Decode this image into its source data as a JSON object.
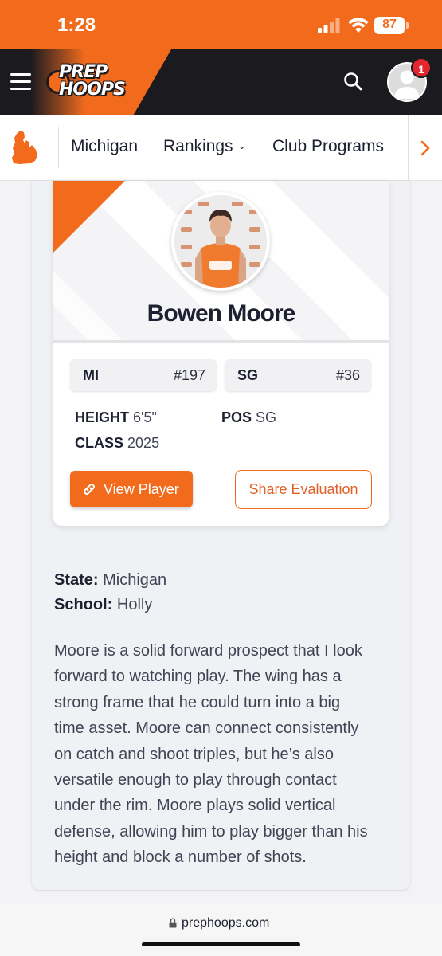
{
  "status_bar": {
    "time": "1:28",
    "battery": "87"
  },
  "header": {
    "logo_line1": "PREP",
    "logo_line2": "HOOPS",
    "notification_count": "1"
  },
  "subnav": {
    "items": [
      {
        "label": "Michigan"
      },
      {
        "label": "Rankings"
      },
      {
        "label": "Club Programs"
      }
    ]
  },
  "player": {
    "name": "Bowen Moore",
    "rankings": [
      {
        "label": "MI",
        "value": "#197"
      },
      {
        "label": "SG",
        "value": "#36"
      }
    ],
    "stats": {
      "height_label": "HEIGHT",
      "height_value": "6'5\"",
      "pos_label": "POS",
      "pos_value": "SG",
      "class_label": "CLASS",
      "class_value": "2025"
    },
    "view_button": "View Player",
    "share_button": "Share Evaluation"
  },
  "info": {
    "state_label": "State:",
    "state_value": "Michigan",
    "school_label": "School:",
    "school_value": "Holly"
  },
  "bio_lines": [
    "Moore is a solid forward prospect that I look",
    "forward to watching play. The wing has a",
    "strong frame that he could turn into a big",
    "time asset. Moore can connect consistently",
    "on catch and shoot triples, but he’s also",
    "versatile enough to play through contact",
    "under the rim. Moore plays solid vertical",
    "defense, allowing him to play bigger than his",
    "height and block a number of shots."
  ],
  "url_bar": {
    "url": "prephoops.com"
  },
  "colors": {
    "brand_orange": "#f26b1d",
    "header_dark": "#1b1b1f",
    "badge_red": "#e3252e"
  }
}
